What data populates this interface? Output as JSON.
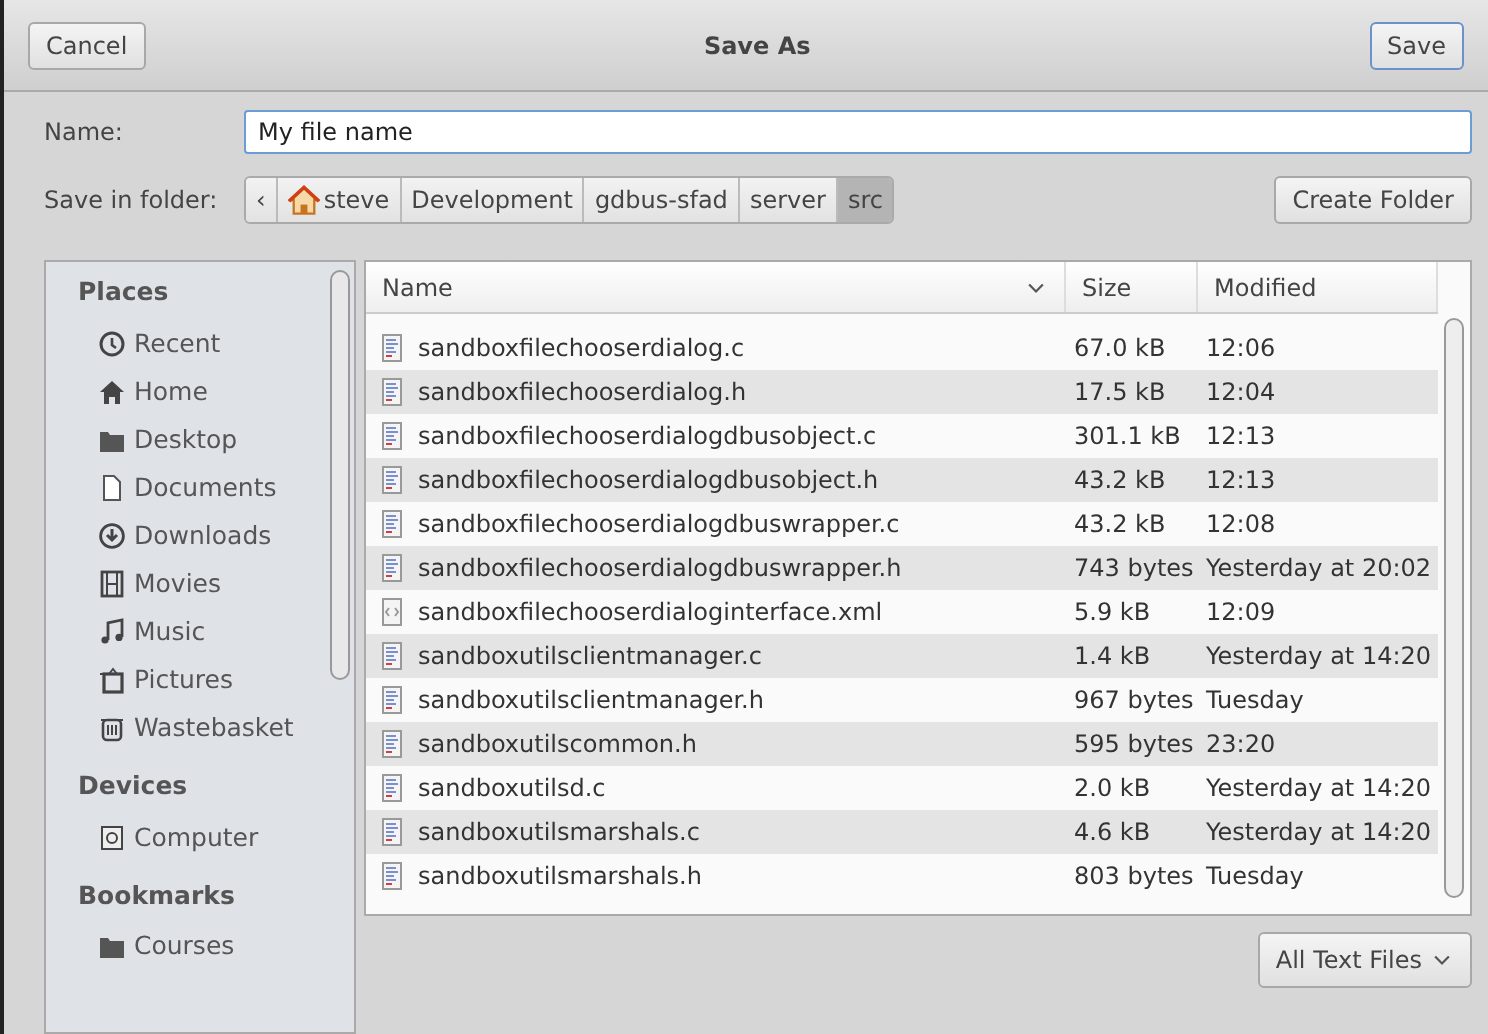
{
  "header": {
    "cancel": "Cancel",
    "title": "Save As",
    "save": "Save"
  },
  "name_row": {
    "label": "Name:",
    "value": "My file name"
  },
  "folder_row": {
    "label": "Save in folder:",
    "back": "‹",
    "crumbs": [
      {
        "label": "steve",
        "kind": "home",
        "selected": false
      },
      {
        "label": "Development",
        "kind": "plain",
        "selected": false
      },
      {
        "label": "gdbus-sfad",
        "kind": "plain",
        "selected": false
      },
      {
        "label": "server",
        "kind": "plain",
        "selected": false
      },
      {
        "label": "src",
        "kind": "plain",
        "selected": true
      }
    ],
    "create_folder": "Create Folder"
  },
  "sidebar": {
    "sections": [
      {
        "title": "Places",
        "items": [
          {
            "label": "Recent",
            "kind": "recent"
          },
          {
            "label": "Home",
            "kind": "home"
          },
          {
            "label": "Desktop",
            "kind": "folder"
          },
          {
            "label": "Documents",
            "kind": "document"
          },
          {
            "label": "Downloads",
            "kind": "download"
          },
          {
            "label": "Movies",
            "kind": "movies"
          },
          {
            "label": "Music",
            "kind": "music"
          },
          {
            "label": "Pictures",
            "kind": "pictures"
          },
          {
            "label": "Wastebasket",
            "kind": "trash"
          }
        ]
      },
      {
        "title": "Devices",
        "items": [
          {
            "label": "Computer",
            "kind": "computer"
          }
        ]
      },
      {
        "title": "Bookmarks",
        "items": [
          {
            "label": "Courses",
            "kind": "folder"
          }
        ]
      }
    ]
  },
  "table": {
    "columns": [
      "Name",
      "Size",
      "Modified"
    ],
    "rows": [
      {
        "name": "sandboxfilechooserdialog.c",
        "size": "67.0 kB",
        "modified": "12:06",
        "kind": "text"
      },
      {
        "name": "sandboxfilechooserdialog.h",
        "size": "17.5 kB",
        "modified": "12:04",
        "kind": "text"
      },
      {
        "name": "sandboxfilechooserdialogdbusobject.c",
        "size": "301.1 kB",
        "modified": "12:13",
        "kind": "text"
      },
      {
        "name": "sandboxfilechooserdialogdbusobject.h",
        "size": "43.2 kB",
        "modified": "12:13",
        "kind": "text"
      },
      {
        "name": "sandboxfilechooserdialogdbuswrapper.c",
        "size": "43.2 kB",
        "modified": "12:08",
        "kind": "text"
      },
      {
        "name": "sandboxfilechooserdialogdbuswrapper.h",
        "size": "743 bytes",
        "modified": "Yesterday at 20:02",
        "kind": "text"
      },
      {
        "name": "sandboxfilechooserdialoginterface.xml",
        "size": "5.9 kB",
        "modified": "12:09",
        "kind": "xml"
      },
      {
        "name": "sandboxutilsclientmanager.c",
        "size": "1.4 kB",
        "modified": "Yesterday at 14:20",
        "kind": "text"
      },
      {
        "name": "sandboxutilsclientmanager.h",
        "size": "967 bytes",
        "modified": "Tuesday",
        "kind": "text"
      },
      {
        "name": "sandboxutilscommon.h",
        "size": "595 bytes",
        "modified": "23:20",
        "kind": "text"
      },
      {
        "name": "sandboxutilsd.c",
        "size": "2.0 kB",
        "modified": "Yesterday at 14:20",
        "kind": "text"
      },
      {
        "name": "sandboxutilsmarshals.c",
        "size": "4.6 kB",
        "modified": "Yesterday at 14:20",
        "kind": "text"
      },
      {
        "name": "sandboxutilsmarshals.h",
        "size": "803 bytes",
        "modified": "Tuesday",
        "kind": "text"
      }
    ]
  },
  "filter": {
    "label": "All Text Files"
  }
}
